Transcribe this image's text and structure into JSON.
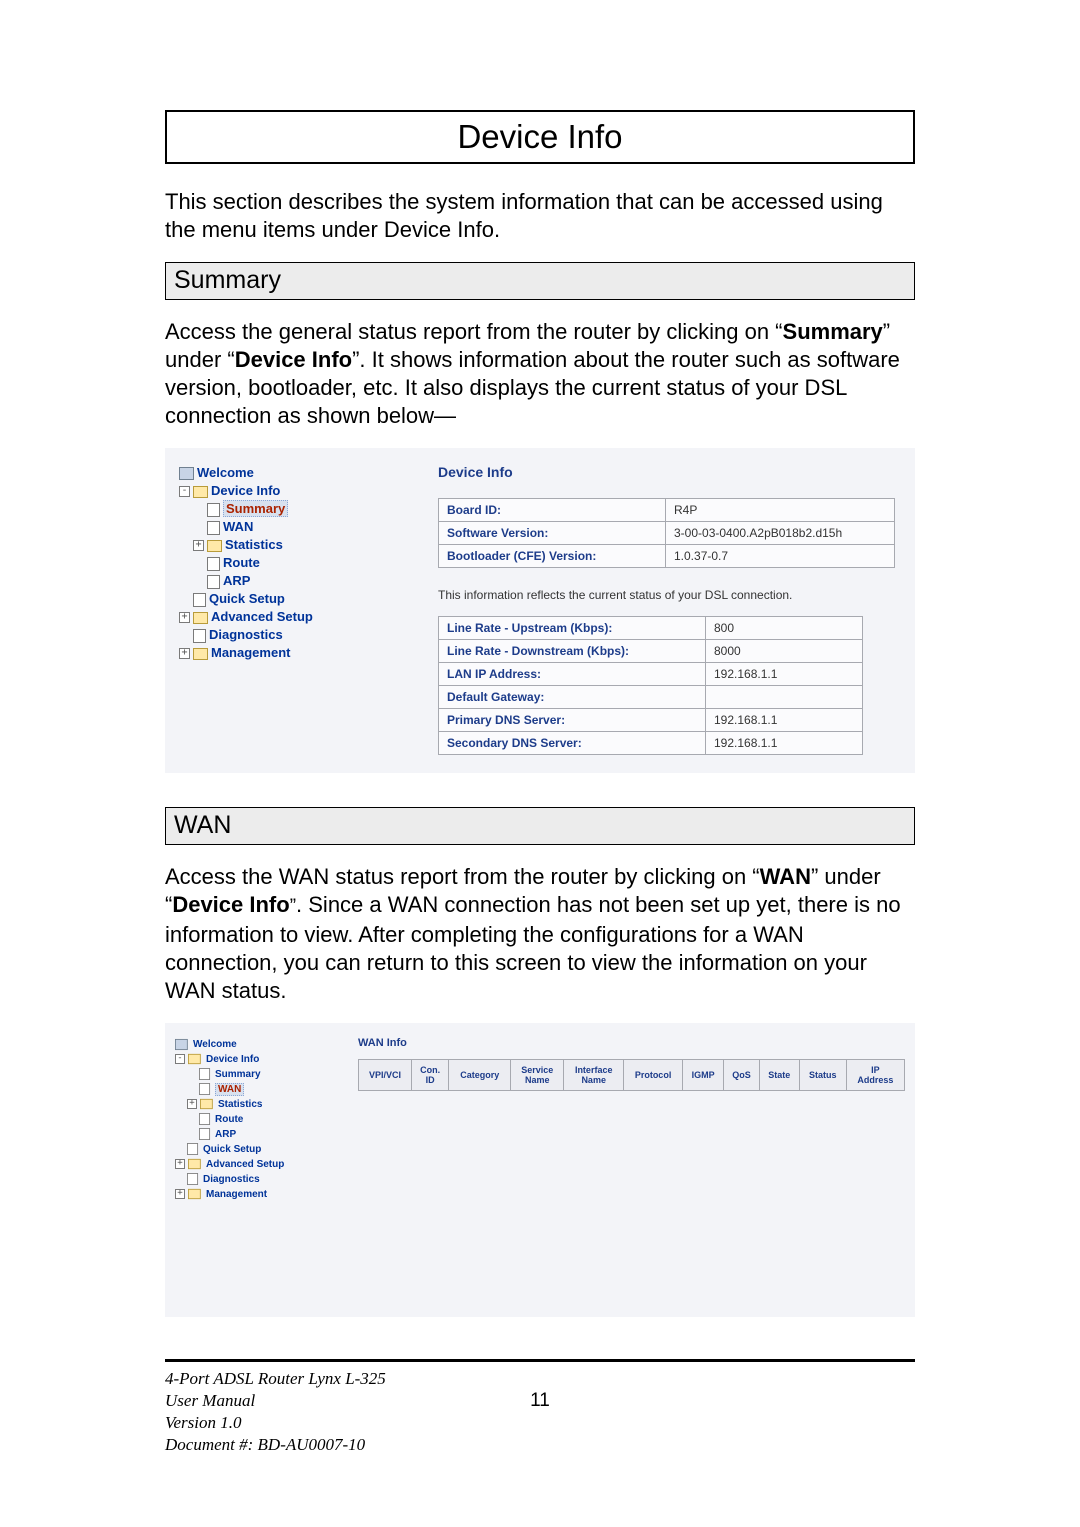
{
  "section_title": "Device Info",
  "intro": "This section describes the system information that can be accessed using the menu items under Device Info.",
  "summary": {
    "heading": "Summary",
    "para_parts": {
      "p1": "Access the general status report from the router by clicking on “",
      "b1": "Summary",
      "p2": "” under “",
      "b2": "Device Info",
      "p3": "”.  It shows information about the router such as software version, bootloader, etc.  It also displays the current status of your DSL connection as shown below—"
    },
    "panel_title": "Device Info",
    "table1": [
      {
        "label": "Board ID:",
        "value": "R4P"
      },
      {
        "label": "Software Version:",
        "value": "3-00-03-0400.A2pB018b2.d15h"
      },
      {
        "label": "Bootloader (CFE) Version:",
        "value": "1.0.37-0.7"
      }
    ],
    "dsl_note": "This information reflects the current status of your DSL connection.",
    "table2": [
      {
        "label": "Line Rate - Upstream (Kbps):",
        "value": "800"
      },
      {
        "label": "Line Rate - Downstream (Kbps):",
        "value": "8000"
      },
      {
        "label": "LAN IP Address:",
        "value": "192.168.1.1"
      },
      {
        "label": "Default Gateway:",
        "value": ""
      },
      {
        "label": "Primary DNS Server:",
        "value": "192.168.1.1"
      },
      {
        "label": "Secondary DNS Server:",
        "value": "192.168.1.1"
      }
    ]
  },
  "tree": {
    "welcome": "Welcome",
    "device_info": "Device Info",
    "summary": "Summary",
    "wan": "WAN",
    "statistics": "Statistics",
    "route": "Route",
    "arp": "ARP",
    "quick_setup": "Quick Setup",
    "advanced_setup": "Advanced Setup",
    "diagnostics": "Diagnostics",
    "management": "Management"
  },
  "wan": {
    "heading": "WAN",
    "para_parts": {
      "p1": "Access the WAN status report from the router by clicking on “",
      "b1": "WAN",
      "p2": "” under “",
      "b2": "Device Info",
      "p3": "”",
      "p4": ".  Since a WAN connection has not been set up yet, there is no information to view.  After completing the configurations for a WAN connection, you can return to this screen to view the information on your WAN status."
    },
    "panel_title": "WAN Info",
    "headers": [
      "VPI/VCI",
      "Con.\nID",
      "Category",
      "Service\nName",
      "Interface\nName",
      "Protocol",
      "IGMP",
      "QoS",
      "State",
      "Status",
      "IP\nAddress"
    ]
  },
  "footer": {
    "l1": "4-Port ADSL Router Lynx L-325",
    "l2": "User Manual",
    "l3": "Version 1.0",
    "l4": "Document #:  BD-AU0007-10",
    "page": "11"
  }
}
